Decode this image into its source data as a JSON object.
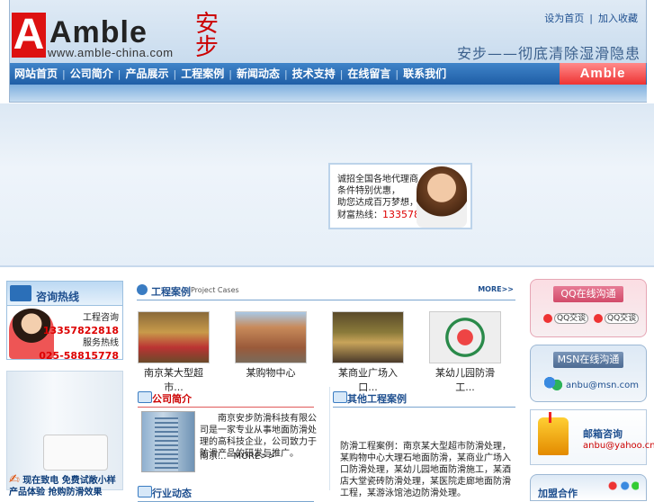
{
  "header": {
    "logo_letter": "A",
    "logo_word": "Amble",
    "logo_url": "www.amble-china.com",
    "logo_cn": "安步",
    "top_links": [
      "设为首页",
      "加入收藏"
    ],
    "top_sep": "|",
    "slogan": "安步——彻底清除湿滑隐患",
    "nav": [
      "网站首页",
      "公司简介",
      "产品展示",
      "工程案例",
      "新闻动态",
      "技术支持",
      "在线留言",
      "联系我们"
    ],
    "nav_sep": "|",
    "badge": "Amble"
  },
  "promo": {
    "lines": [
      "诚招全国各地代理商，",
      "条件特别优惠，",
      "助您达成百万梦想，"
    ],
    "hotline_label": "财富热线：",
    "hotline_number": "13357822818"
  },
  "left": {
    "hotline_title": "咨询热线",
    "consult_label": "工程咨询",
    "consult_number": "13357822818",
    "service_label": "服务热线",
    "service_number": "025-58815778",
    "promo_caption_1": "现在致电  免费试敞小样",
    "promo_caption_2": "产品体验  抢购防滑效果"
  },
  "cases": {
    "title": "工程案例",
    "subtitle": "Project Cases",
    "more": "MORE>>",
    "items": [
      "南京某大型超市...",
      "某购物中心",
      "某商业广场入口...",
      "某幼儿园防滑工..."
    ]
  },
  "about": {
    "title": "公司简介",
    "text": "南京安步防滑科技有限公司是一家专业从事地面防滑处理的高科技企业，公司致力于防滑产品的研发与推广。",
    "tail": "南京...",
    "more": "MORE>>"
  },
  "other_cases": {
    "title": "其他工程案例",
    "text": "防滑工程案例：南京某大型超市防滑处理，某购物中心大理石地面防滑，某商业广场入口防滑处理，某幼儿园地面防滑施工，某酒店大堂瓷砖防滑处理，某医院走廊地面防滑工程，某游泳馆池边防滑处理。"
  },
  "news": {
    "title": "行业动态"
  },
  "right": {
    "qq_title": "QQ在线沟通",
    "qq_buttons": [
      "QQ交谈",
      "QQ交谈"
    ],
    "msn_title": "MSN在线沟通",
    "msn_account": "anbu@msn.com",
    "mail_title": "邮箱咨询",
    "mail_account": "anbu@yahoo.cn",
    "join_title": "加盟合作"
  },
  "colors": {
    "nav": "#1f5ea6",
    "accent_red": "#d11111",
    "link_blue": "#1e4f8f"
  }
}
